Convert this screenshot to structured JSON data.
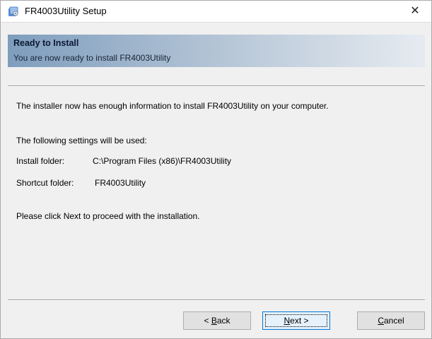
{
  "window": {
    "title": "FR4003Utility Setup",
    "close_glyph": "✕"
  },
  "header": {
    "title": "Ready to Install",
    "subtitle": "You are now ready to install FR4003Utility"
  },
  "content": {
    "intro": "The installer now has enough information to install FR4003Utility on your computer.",
    "settings_heading": "The following settings will be used:",
    "install_folder_label": "Install folder:",
    "install_folder_value": "C:\\Program Files (x86)\\FR4003Utility",
    "shortcut_folder_label": "Shortcut folder:",
    "shortcut_folder_value": "FR4003Utility",
    "instruction": "Please click Next to proceed with the installation."
  },
  "buttons": {
    "back": {
      "prefix": "< ",
      "mnemonic": "B",
      "rest": "ack"
    },
    "next": {
      "mnemonic": "N",
      "rest": "ext >"
    },
    "cancel": {
      "mnemonic": "C",
      "rest": "ancel"
    }
  },
  "colors": {
    "header_gradient_start": "#7e9dbd",
    "header_gradient_end": "#e6ebf1",
    "default_button_border": "#0078d7"
  },
  "icons": {
    "app": "installer-icon",
    "close": "close-icon"
  }
}
